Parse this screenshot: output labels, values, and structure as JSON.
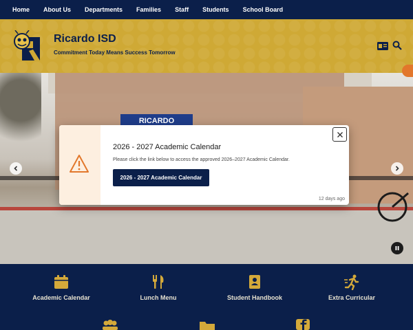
{
  "nav": {
    "items": [
      "Home",
      "About Us",
      "Departments",
      "Families",
      "Staff",
      "Students",
      "School Board"
    ]
  },
  "header": {
    "site_name": "Ricardo ISD",
    "tagline": "Commitment Today Means Success Tomorrow"
  },
  "hero": {
    "sign_text": "RICARDO"
  },
  "alert": {
    "title": "2026 - 2027 Academic Calendar",
    "text": "Please click the link below to access the approved 2026–2027 Academic Calendar.",
    "button_label": "2026 - 2027 Academic Calendar",
    "timestamp": "12 days ago"
  },
  "quick_links": {
    "items": [
      {
        "label": "Academic Calendar",
        "icon": "calendar-icon"
      },
      {
        "label": "Lunch Menu",
        "icon": "utensils-icon"
      },
      {
        "label": "Student Handbook",
        "icon": "handbook-icon"
      },
      {
        "label": "Extra Curricular",
        "icon": "runner-icon"
      }
    ]
  },
  "colors": {
    "navy": "#0b1f4a",
    "gold": "#cfa935",
    "icon_gold": "#d4a93a",
    "alert_orange": "#e2772b"
  }
}
